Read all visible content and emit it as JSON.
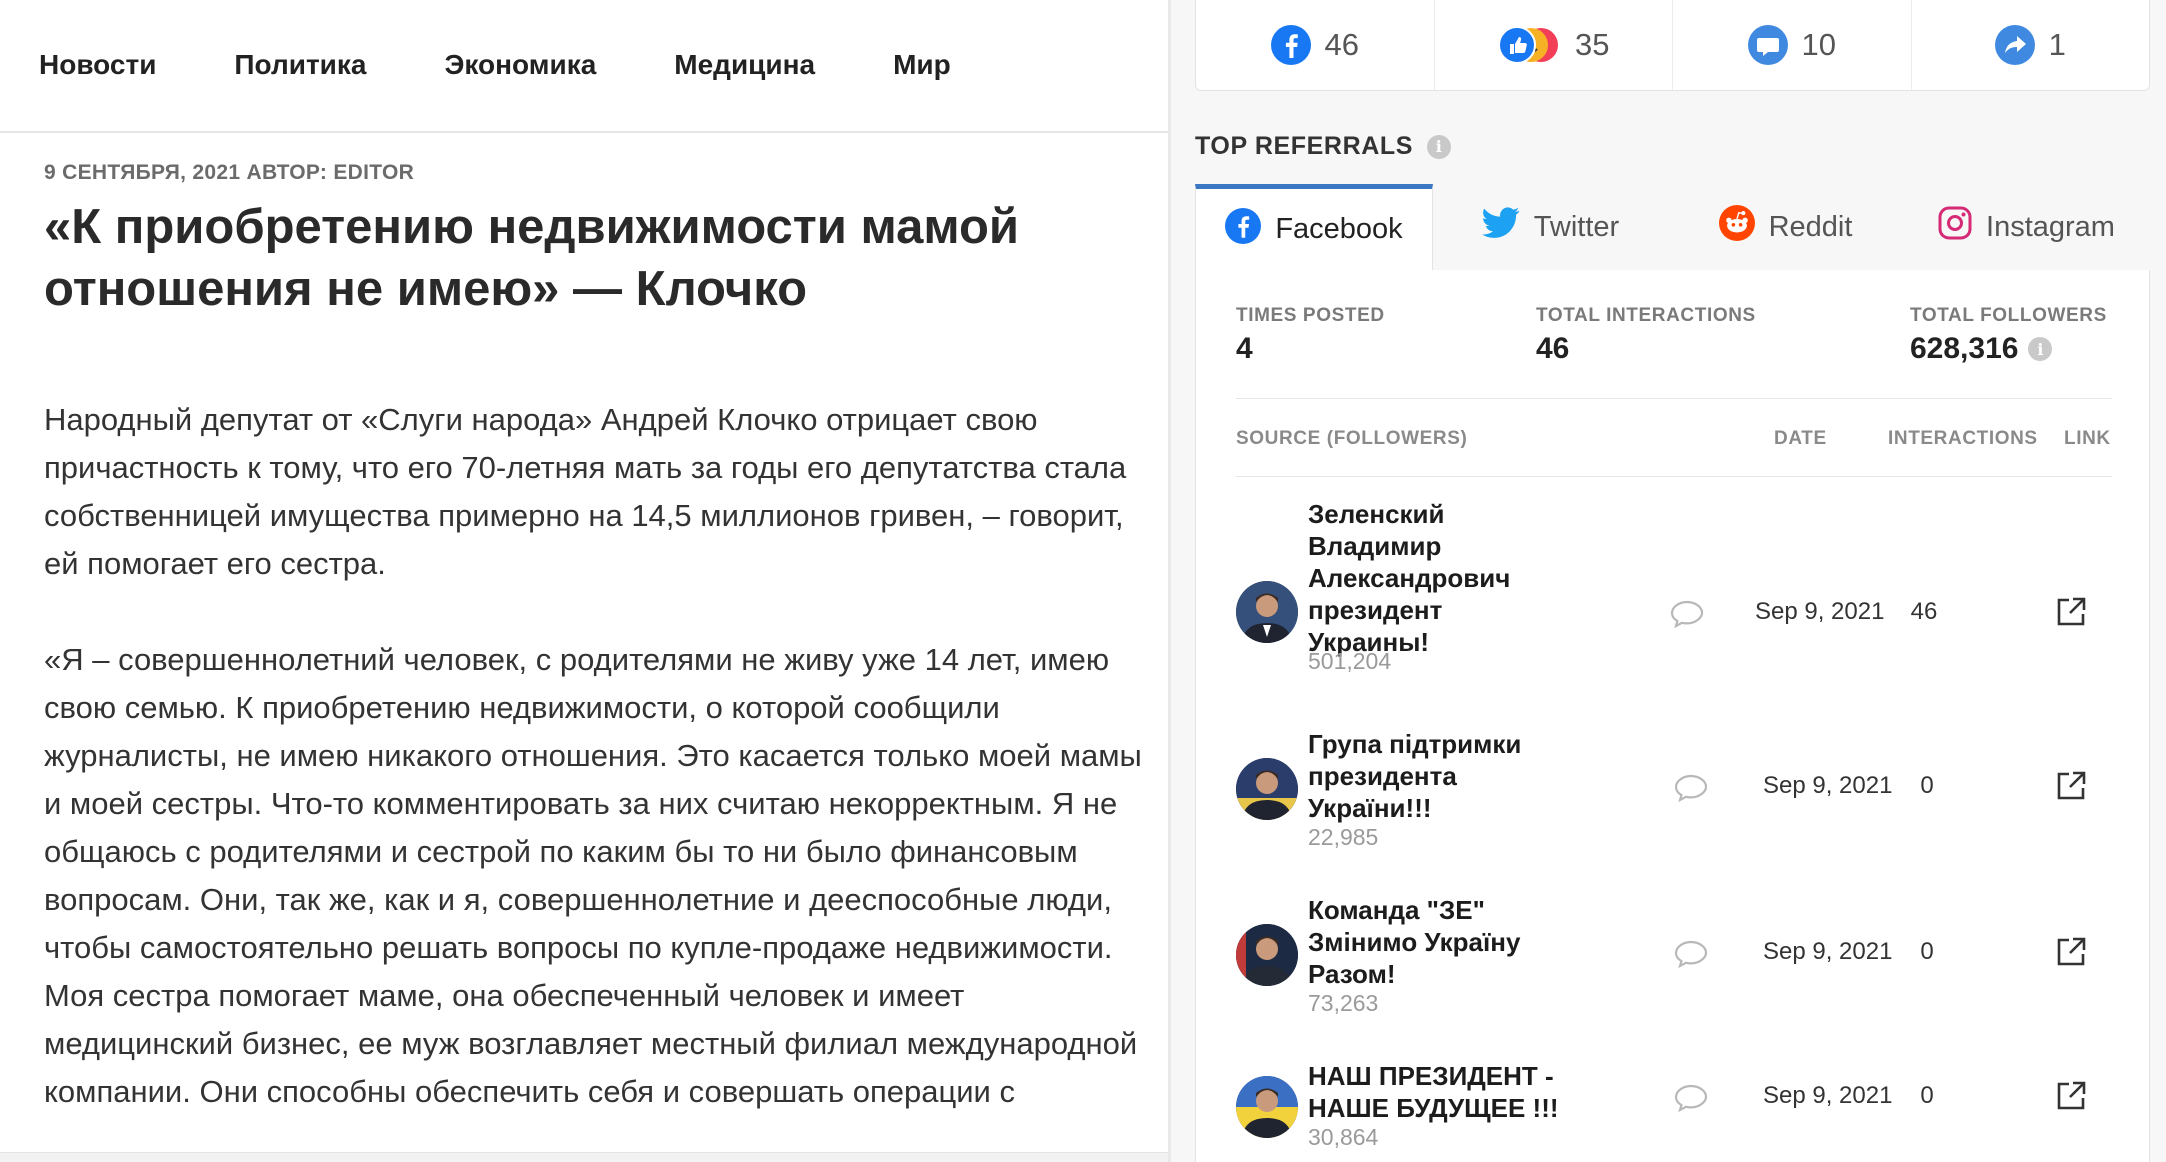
{
  "article": {
    "nav": [
      "Новости",
      "Политика",
      "Экономика",
      "Медицина",
      "Мир"
    ],
    "meta": "9 СЕНТЯБРЯ, 2021 АВТОР: EDITOR",
    "headline": "«К приобретению недвижимости мамой отношения не имею» — Клочко",
    "paragraph1": "Народный депутат от «Слуги народа» Андрей Клочко отрицает свою причастность к тому, что его 70-летняя мать за годы его депутатства стала собственницей имущества примерно на 14,5 миллионов гривен, – говорит, ей помогает его сестра.",
    "paragraph2": "«Я – совершеннолетний человек, с родителями не живу уже 14 лет, имею свою семью. К приобретению недвижимости, о которой сообщили журналисты, не имею никакого отношения. Это касается только моей мамы и моей сестры. Что-то комментировать за них считаю некорректным. Я не общаюсь с родителями и сестрой по каким бы то ни было финансовым вопросам. Они, так же, как и я, совершеннолетние и дееспособные люди, чтобы самостоятельно решать вопросы по купле-продаже недвижимости. Моя сестра помогает маме, она обеспеченный человек и имеет медицинский бизнес, ее муж возглавляет местный филиал международной компании. Они способны обеспечить себя и совершать операции с"
  },
  "stats": [
    {
      "icon": "facebook-icon",
      "value": "46"
    },
    {
      "icon": "reactions-icon",
      "value": "35"
    },
    {
      "icon": "comment-icon",
      "value": "10"
    },
    {
      "icon": "share-icon",
      "value": "1"
    }
  ],
  "referrals": {
    "title": "TOP REFERRALS",
    "tabs": [
      {
        "label": "Facebook",
        "icon": "facebook-icon",
        "active": true
      },
      {
        "label": "Twitter",
        "icon": "twitter-icon",
        "active": false
      },
      {
        "label": "Reddit",
        "icon": "reddit-icon",
        "active": false
      },
      {
        "label": "Instagram",
        "icon": "instagram-icon",
        "active": false
      }
    ],
    "summary": {
      "times_posted_label": "TIMES POSTED",
      "times_posted": "4",
      "total_interactions_label": "TOTAL INTERACTIONS",
      "total_interactions": "46",
      "total_followers_label": "TOTAL FOLLOWERS",
      "total_followers": "628,316"
    },
    "columns": {
      "source": "SOURCE (FOLLOWERS)",
      "date": "DATE",
      "interactions": "INTERACTIONS",
      "link": "LINK"
    },
    "rows": [
      {
        "name": "Зеленский Владимир Александрович президент Украины!",
        "followers": "501,204",
        "date": "Sep 9, 2021",
        "interactions": "46"
      },
      {
        "name": "Група підтримки президента України!!!",
        "followers": "22,985",
        "date": "Sep 9, 2021",
        "interactions": "0"
      },
      {
        "name": "Команда \"ЗЕ\" Змінимо Україну Разом!",
        "followers": "73,263",
        "date": "Sep 9, 2021",
        "interactions": "0"
      },
      {
        "name": "НАШ ПРЕЗИДЕНТ - НАШЕ БУДУЩЕЕ !!!",
        "followers": "30,864",
        "date": "Sep 9, 2021",
        "interactions": "0"
      }
    ]
  },
  "colors": {
    "facebook": "#1877f2",
    "twitter": "#1da1f2",
    "reddit": "#ff4500",
    "instagram": "#d62976",
    "tab_active": "#3b78c4"
  }
}
